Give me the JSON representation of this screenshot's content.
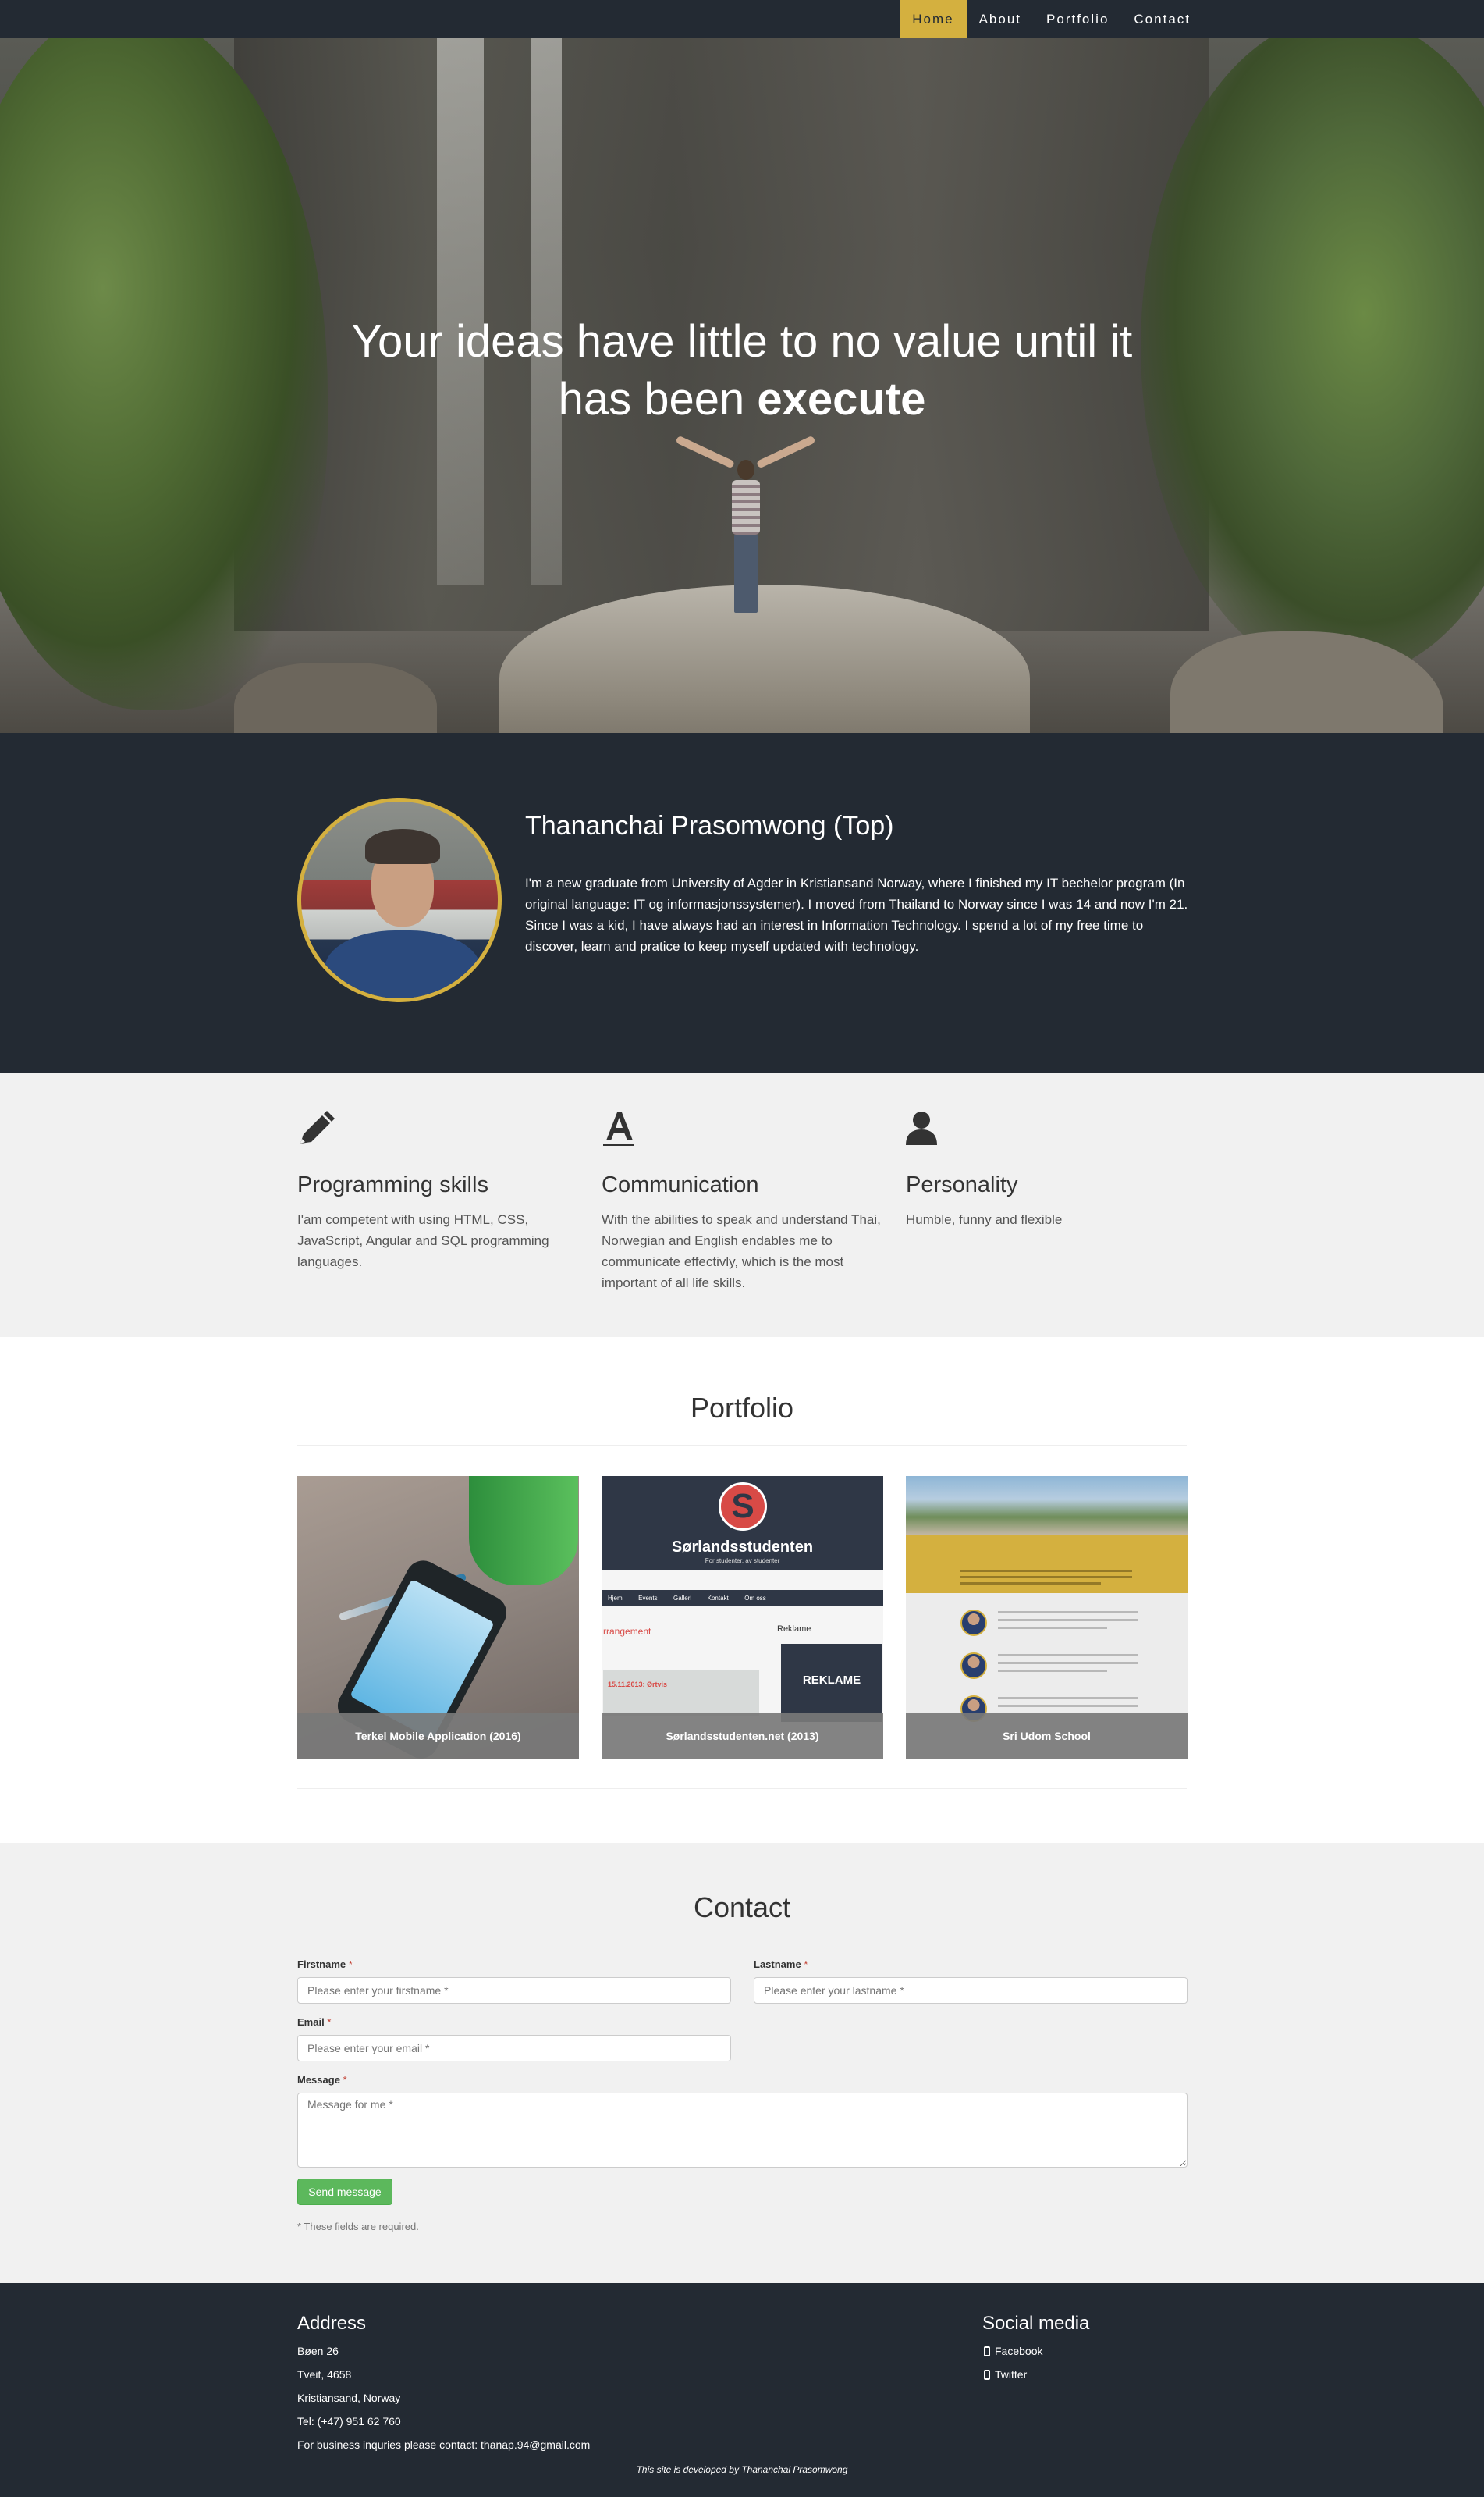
{
  "nav": {
    "items": [
      {
        "label": "Home",
        "active": true
      },
      {
        "label": "About"
      },
      {
        "label": "Portfolio"
      },
      {
        "label": "Contact"
      }
    ]
  },
  "hero": {
    "title_line1": "Your ideas have little to no value until it",
    "title_line2_prefix": "has been ",
    "title_line2_bold": "execute"
  },
  "about": {
    "name": "Thananchai Prasomwong (Top)",
    "text": "I'm a new graduate from University of Agder in Kristiansand Norway, where I finished my IT bechelor program (In original language: IT og informasjonssystemer). I moved from Thailand to Norway since I was 14 and now I'm 21. Since I was a kid, I have always had an interest in Information Technology. I spend a lot of my free time to discover, learn and pratice to keep myself updated with technology."
  },
  "skills": [
    {
      "icon": "pencil-icon",
      "title": "Programming skills",
      "text": "I'am competent with using HTML, CSS, JavaScript, Angular and SQL programming languages."
    },
    {
      "icon": "font-icon",
      "title": "Communication",
      "text": "With the abilities to speak and understand Thai, Norwegian and English endables me to communicate effectivly, which is the most important of all life skills."
    },
    {
      "icon": "user-icon",
      "title": "Personality",
      "text": "Humble, funny and flexible"
    }
  ],
  "portfolio": {
    "title": "Portfolio",
    "items": [
      {
        "caption": "Terkel Mobile Application (2016)"
      },
      {
        "caption": "Sørlandsstudenten.net (2013)",
        "screenshot": {
          "brand": "Sørlandsstudenten",
          "logo_letter": "S",
          "sub": "For studenter, av studenter",
          "menu": [
            "Hjem",
            "Events",
            "Galleri",
            "Kontakt",
            "Om oss"
          ],
          "heading": "rrangement",
          "reklame_heading": "Reklame",
          "ad": "REKLAME",
          "date": "15.11.2013: Ørtvis"
        }
      },
      {
        "caption": "Sri Udom School"
      }
    ]
  },
  "contact": {
    "title": "Contact",
    "firstname_label": "Firstname",
    "firstname_placeholder": "Please enter your firstname *",
    "lastname_label": "Lastname",
    "lastname_placeholder": "Please enter your lastname *",
    "email_label": "Email",
    "email_placeholder": "Please enter your email *",
    "message_label": "Message",
    "message_placeholder": "Message for me *",
    "required_mark": "*",
    "send_label": "Send message",
    "note": "* These fields are required."
  },
  "footer": {
    "address_title": "Address",
    "address_lines": [
      "Bøen 26",
      "Tveit, 4658",
      "Kristiansand, Norway",
      "Tel: (+47) 951 62 760",
      "For business inquries please contact: thanap.94@gmail.com"
    ],
    "social_title": "Social media",
    "social": [
      "Facebook",
      "Twitter"
    ],
    "credit": "This site is developed by Thananchai Prasomwong"
  },
  "colors": {
    "dark": "#232a33",
    "accent": "#d4b03f",
    "light_bg": "#f1f1f1",
    "send": "#5cb85c"
  }
}
